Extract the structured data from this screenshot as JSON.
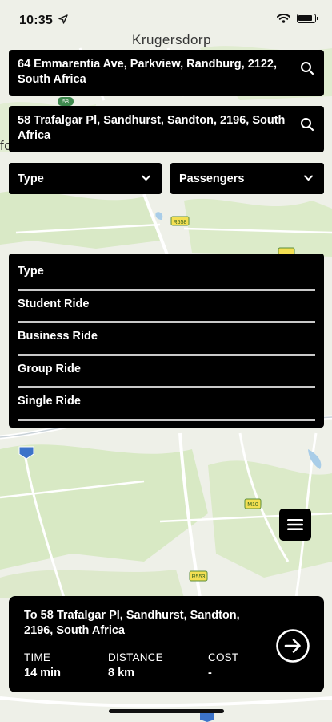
{
  "status": {
    "time": "10:35"
  },
  "map": {
    "city_label": "Krugersdorp",
    "edge_label": "fo"
  },
  "pickup": {
    "address": "64 Emmarentia Ave, Parkview, Randburg, 2122, South Africa"
  },
  "destination": {
    "address": "58 Trafalgar Pl, Sandhurst, Sandton, 2196, South Africa"
  },
  "filters": {
    "type_label": "Type",
    "passengers_label": "Passengers"
  },
  "type_options": [
    "Type",
    "Student Ride",
    "Business Ride",
    "Group Ride",
    "Single Ride"
  ],
  "trip": {
    "to_prefix": "To",
    "destination": "58 Trafalgar Pl, Sandhurst, Sandton, 2196, South Africa",
    "time_label": "TIME",
    "time_value": "14 min",
    "distance_label": "DISTANCE",
    "distance_value": "8 km",
    "cost_label": "COST",
    "cost_value": "-"
  },
  "icons": {
    "search": "search-icon",
    "chevron": "chevron-down-icon",
    "menu": "hamburger-menu-icon",
    "go": "arrow-right-circle-icon",
    "location": "location-arrow-icon",
    "wifi": "wifi-icon",
    "battery": "battery-icon"
  },
  "colors": {
    "panel": "#000000",
    "text": "#ffffff",
    "divider": "#c9c9c9",
    "map_bg": "#eef0e8",
    "park": "#d6e8c4"
  }
}
